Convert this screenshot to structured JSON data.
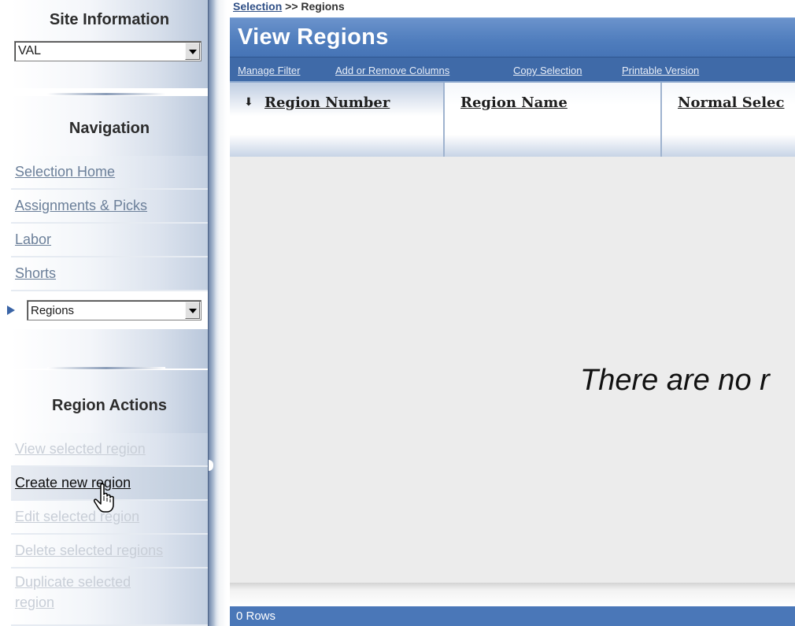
{
  "sidebar": {
    "site_info": {
      "title": "Site Information",
      "site_select_value": "VAL"
    },
    "navigation": {
      "title": "Navigation",
      "items": [
        {
          "label": "Selection Home",
          "state": "link"
        },
        {
          "label": "Assignments & Picks",
          "state": "link"
        },
        {
          "label": "Labor",
          "state": "link"
        },
        {
          "label": "Shorts",
          "state": "link"
        }
      ],
      "current_select_value": "Regions"
    },
    "region_actions": {
      "title": "Region Actions",
      "items": [
        {
          "label": "View selected region",
          "state": "disabled"
        },
        {
          "label": "Create new region",
          "state": "active"
        },
        {
          "label": "Edit selected region",
          "state": "disabled"
        },
        {
          "label": "Delete selected regions",
          "state": "disabled"
        },
        {
          "label": "Duplicate selected region",
          "state": "disabled"
        }
      ]
    }
  },
  "breadcrumb": {
    "link": "Selection",
    "separator": " >> ",
    "current": "Regions"
  },
  "main": {
    "title": "View Regions",
    "toolbar_links": [
      "Manage Filter",
      "Add or Remove Columns",
      "Copy Selection",
      "Printable Version"
    ],
    "columns": [
      {
        "label": "Region Number",
        "sorted": true,
        "sort_glyph": "⬇"
      },
      {
        "label": "Region Name",
        "sorted": false
      },
      {
        "label": "Normal Selec",
        "sorted": false
      }
    ],
    "empty_message": "There are no r",
    "status": "0 Rows"
  },
  "colors": {
    "header_blue": "#4f7dbd",
    "toolbar_blue": "#3f6aa8",
    "status_blue": "#4a77b8",
    "link_blue_gray": "#6b7f99",
    "disabled_gray": "#c8ced7"
  }
}
